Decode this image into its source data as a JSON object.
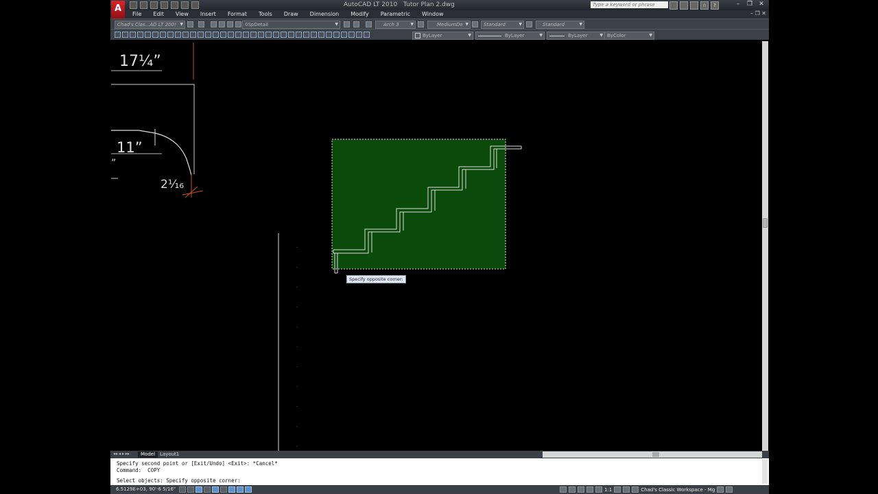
{
  "app": {
    "title_app": "AutoCAD LT 2010",
    "title_file": "Tutor Plan 2.dwg",
    "search_placeholder": "Type a keyword or phrase",
    "logo_letter": "A"
  },
  "menu": [
    "File",
    "Edit",
    "View",
    "Insert",
    "Format",
    "Tools",
    "Draw",
    "Dimension",
    "Modify",
    "Parametric",
    "Window"
  ],
  "toolbar1": {
    "workspace": "Chad's Clas...AD LT 200!",
    "layer": "0SpDetail",
    "text_style": "Arch 3",
    "dim_style": "MediumDe",
    "table_style": "Standard",
    "mleader_style": "Standard"
  },
  "toolbar2": {
    "color": "ByLayer",
    "linetype": "ByLayer",
    "lineweight": "ByLayer",
    "plotstyle": "ByColor"
  },
  "drawing": {
    "dim_top": "17¼”",
    "dim_mid": "11”",
    "dim_small": "2¹⁄₁₆",
    "dim_partial": "”",
    "tooltip": "Specify opposite corner:",
    "selection_color": "#0a4a0a"
  },
  "tabs": {
    "model": "Model",
    "layout": "Layout1"
  },
  "command": {
    "line1": "Specify second point or [Exit/Undo] <Exit>: *Cancel*",
    "line2": "Command:  COPY",
    "line3": "Select objects: Specify opposite corner:"
  },
  "status": {
    "coords": "6.5129E+03,  90'-6 5/16\"",
    "scale": "1:1",
    "workspace": "Chad's Classic Workspace - Mg"
  }
}
